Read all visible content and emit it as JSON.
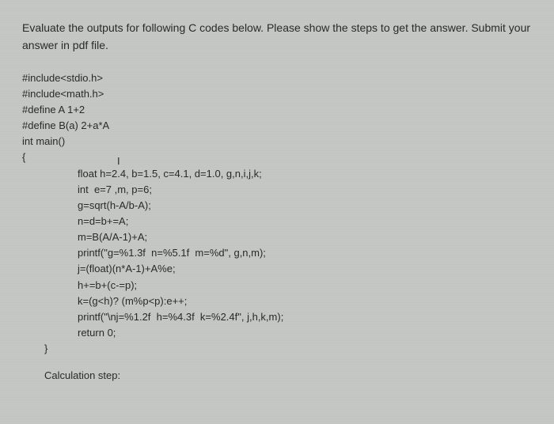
{
  "instruction": "Evaluate the outputs for following C codes below. Please show the steps to get the answer. Submit your answer in pdf file.",
  "code": {
    "lines": [
      "#include<stdio.h>",
      "#include<math.h>",
      "#define A 1+2",
      "#define B(a) 2+a*A",
      "int main()",
      "{"
    ],
    "cursor_mark": "I",
    "body": [
      "float h=2.4, b=1.5, c=4.1, d=1.0, g,n,i,j,k;",
      "int  e=7 ,m, p=6;",
      "g=sqrt(h-A/b-A);",
      "n=d=b+=A;",
      "m=B(A/A-1)+A;",
      "printf(\"g=%1.3f  n=%5.1f  m=%d\", g,n,m);",
      "j=(float)(n*A-1)+A%e;",
      "h+=b+(c-=p);",
      "k=(g<h)? (m%p<p):e++;",
      "printf(\"\\nj=%1.2f  h=%4.3f  k=%2.4f\", j,h,k,m);",
      "return 0;"
    ],
    "close": "}"
  },
  "calc_label": "Calculation step:"
}
